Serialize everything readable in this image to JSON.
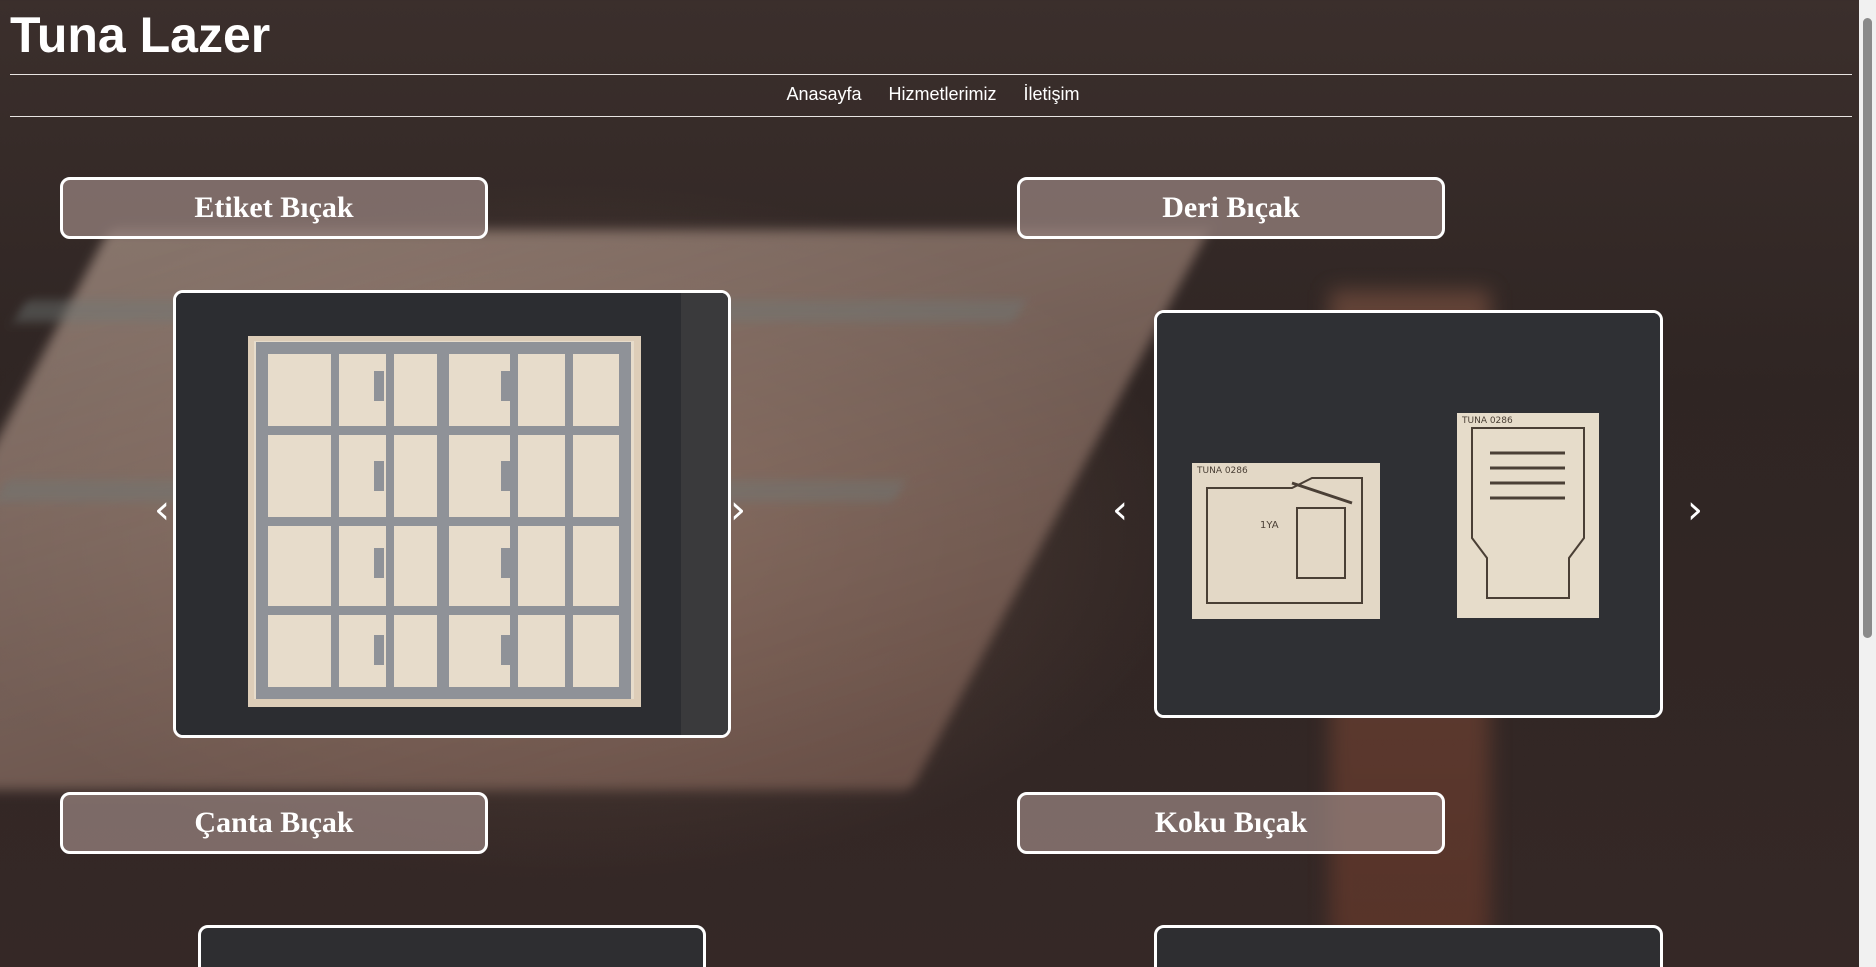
{
  "site": {
    "title": "Tuna Lazer"
  },
  "nav": {
    "items": [
      "Anasayfa",
      "Hizmetlerimiz",
      "İletişim"
    ]
  },
  "sections": [
    {
      "title": "Etiket Bıçak"
    },
    {
      "title": "Deri Bıçak"
    },
    {
      "title": "Çanta Bıçak"
    },
    {
      "title": "Koku Bıçak"
    }
  ],
  "carousel": {
    "prev": "‹",
    "next": "›"
  },
  "photo_labels": {
    "small": "TUNA 0286",
    "mid": "1YA"
  },
  "colors": {
    "frame_border": "#ffffff",
    "title_bg": "#968280"
  },
  "icons": {
    "prev": "chevron-left-icon",
    "next": "chevron-right-icon"
  }
}
